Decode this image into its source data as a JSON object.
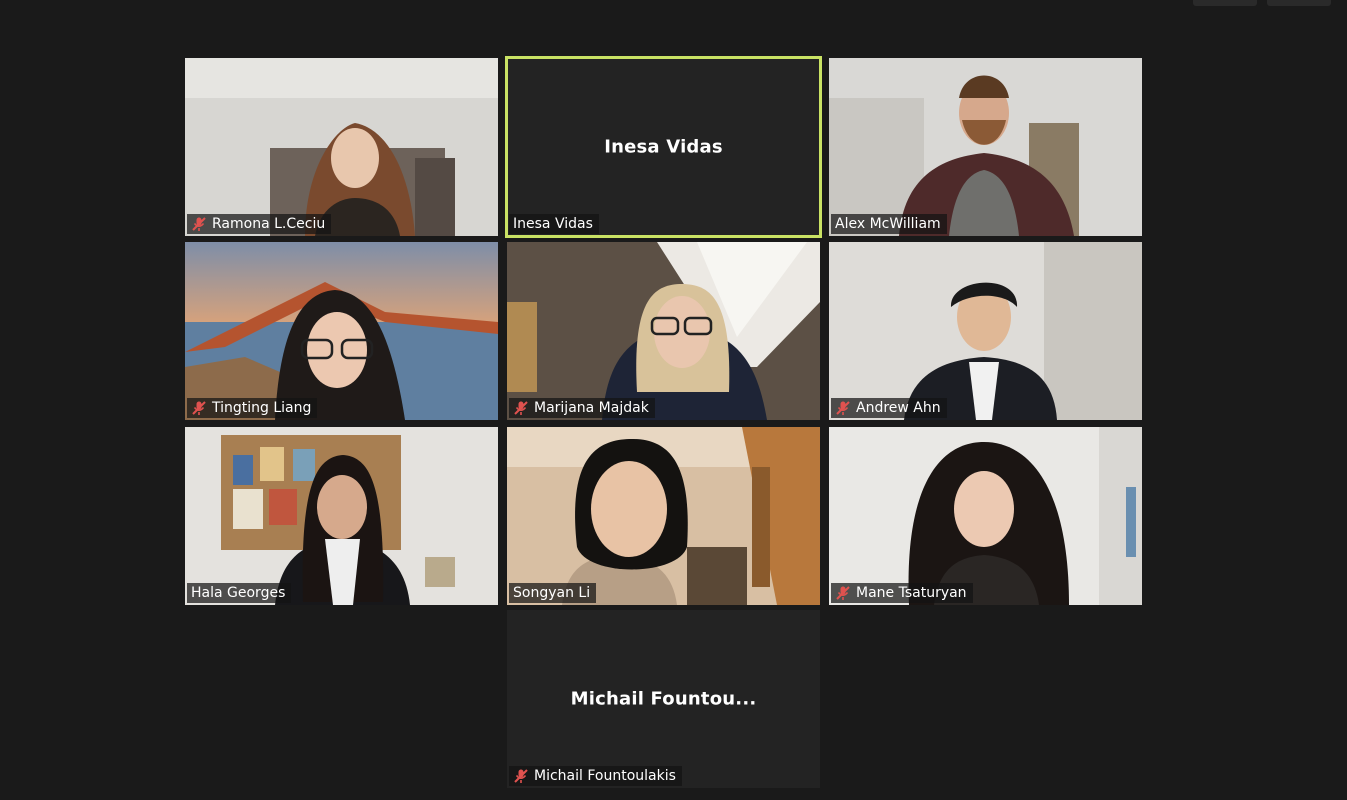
{
  "colors": {
    "background": "#1a1a1a",
    "active_speaker_border": "#c9e264",
    "muted_icon": "#e0524f",
    "tile_bg": "#232323"
  },
  "participants": [
    {
      "name": "Ramona L.Ceciu",
      "muted": true,
      "video": true
    },
    {
      "name": "Inesa Vidas",
      "muted": false,
      "video": false,
      "active_speaker": true,
      "display_name": "Inesa Vidas"
    },
    {
      "name": "Alex McWilliam",
      "muted": false,
      "video": true
    },
    {
      "name": "Tingting Liang",
      "muted": true,
      "video": true
    },
    {
      "name": "Marijana Majdak",
      "muted": true,
      "video": true
    },
    {
      "name": "Andrew Ahn",
      "muted": true,
      "video": true
    },
    {
      "name": "Hala Georges",
      "muted": false,
      "video": true
    },
    {
      "name": "Songyan Li",
      "muted": false,
      "video": true
    },
    {
      "name": "Mane Tsaturyan",
      "muted": true,
      "video": true
    },
    {
      "name": "Michail Fountoulakis",
      "muted": true,
      "video": false,
      "display_name": "Michail Fountou..."
    }
  ]
}
